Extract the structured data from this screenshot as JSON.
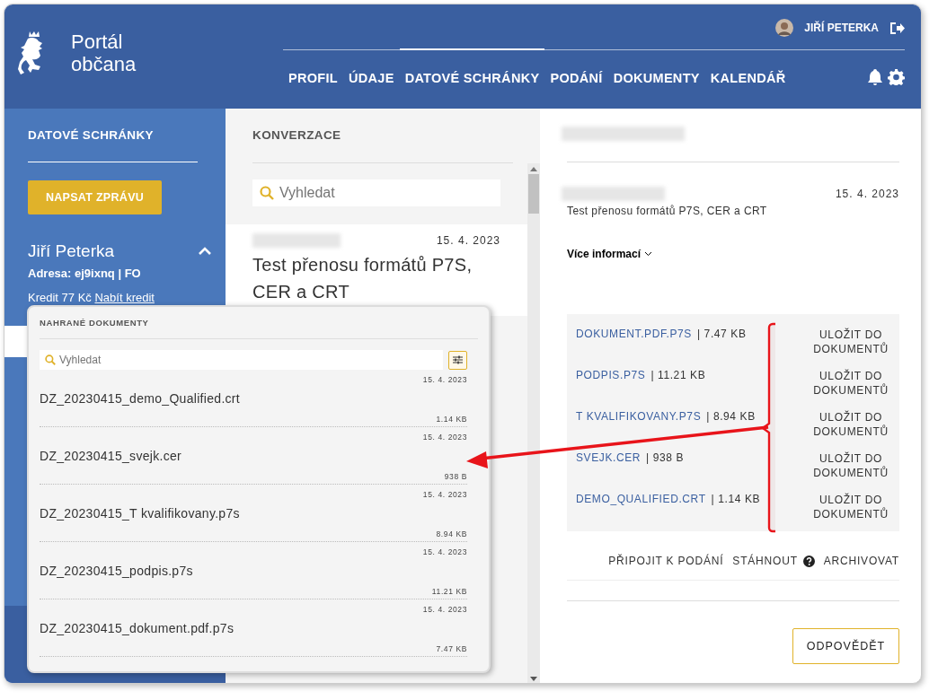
{
  "header": {
    "logo_line1": "Portál",
    "logo_line2": "občana",
    "user_name": "JIŘÍ PETERKA",
    "nav": [
      {
        "label": "PROFIL",
        "selected": false
      },
      {
        "label": "ÚDAJE",
        "selected": false
      },
      {
        "label": "DATOVÉ SCHRÁNKY",
        "selected": true
      },
      {
        "label": "PODÁNÍ",
        "selected": false
      },
      {
        "label": "DOKUMENTY",
        "selected": false
      },
      {
        "label": "KALENDÁŘ",
        "selected": false
      }
    ]
  },
  "sidebar": {
    "title": "DATOVÉ SCHRÁNKY",
    "compose_button": "NAPSAT ZPRÁVU",
    "account": {
      "name": "Jiří Peterka",
      "expanded": true,
      "address": "Adresa: ej9ixnq | FO",
      "credit": "Kredit 77 Kč",
      "credit_link": "Nabít kredit"
    }
  },
  "conversations": {
    "title": "KONVERZACE",
    "search": {
      "placeholder": "Vyhledat"
    },
    "items": [
      {
        "date": "15. 4. 2023",
        "subject": "Test přenosu formátů P7S, CER a CRT"
      }
    ]
  },
  "detail": {
    "date": "15. 4. 2023",
    "subject": "Test přenosu formátů P7S, CER a CRT",
    "more_info": "Více informací",
    "attachments": [
      {
        "name": "DOKUMENT.PDF.P7S",
        "size": "| 7.47 KB",
        "action": "ULOŽIT DO DOKUMENTŮ"
      },
      {
        "name": "PODPIS.P7S",
        "size": "| 11.21 KB",
        "action": "ULOŽIT DO DOKUMENTŮ"
      },
      {
        "name": "T KVALIFIKOVANY.P7S",
        "size": "| 8.94 KB",
        "action": "ULOŽIT DO DOKUMENTŮ"
      },
      {
        "name": "SVEJK.CER",
        "size": "| 938 B",
        "action": "ULOŽIT DO DOKUMENTŮ"
      },
      {
        "name": "DEMO_QUALIFIED.CRT",
        "size": "| 1.14 KB",
        "action": "ULOŽIT DO DOKUMENTŮ"
      }
    ],
    "actions": [
      {
        "label": "PŘIPOJIT K PODÁNÍ",
        "help": false
      },
      {
        "label": "STÁHNOUT",
        "help": true
      },
      {
        "label": "ARCHIVOVAT",
        "help": false
      }
    ],
    "reply_button": "ODPOVĚDĚT"
  },
  "popup": {
    "title": "NAHRANÉ DOKUMENTY",
    "search": {
      "placeholder": "Vyhledat"
    },
    "files": [
      {
        "date": "15. 4. 2023",
        "name": "DZ_20230415_demo_Qualified.crt",
        "size": "1.14 KB"
      },
      {
        "date": "15. 4. 2023",
        "name": "DZ_20230415_svejk.cer",
        "size": "938 B"
      },
      {
        "date": "15. 4. 2023",
        "name": "DZ_20230415_T kvalifikovany.p7s",
        "size": "8.94 KB"
      },
      {
        "date": "15. 4. 2023",
        "name": "DZ_20230415_podpis.p7s",
        "size": "11.21 KB"
      },
      {
        "date": "15. 4. 2023",
        "name": "DZ_20230415_dokument.pdf.p7s",
        "size": "7.47 KB"
      }
    ]
  }
}
